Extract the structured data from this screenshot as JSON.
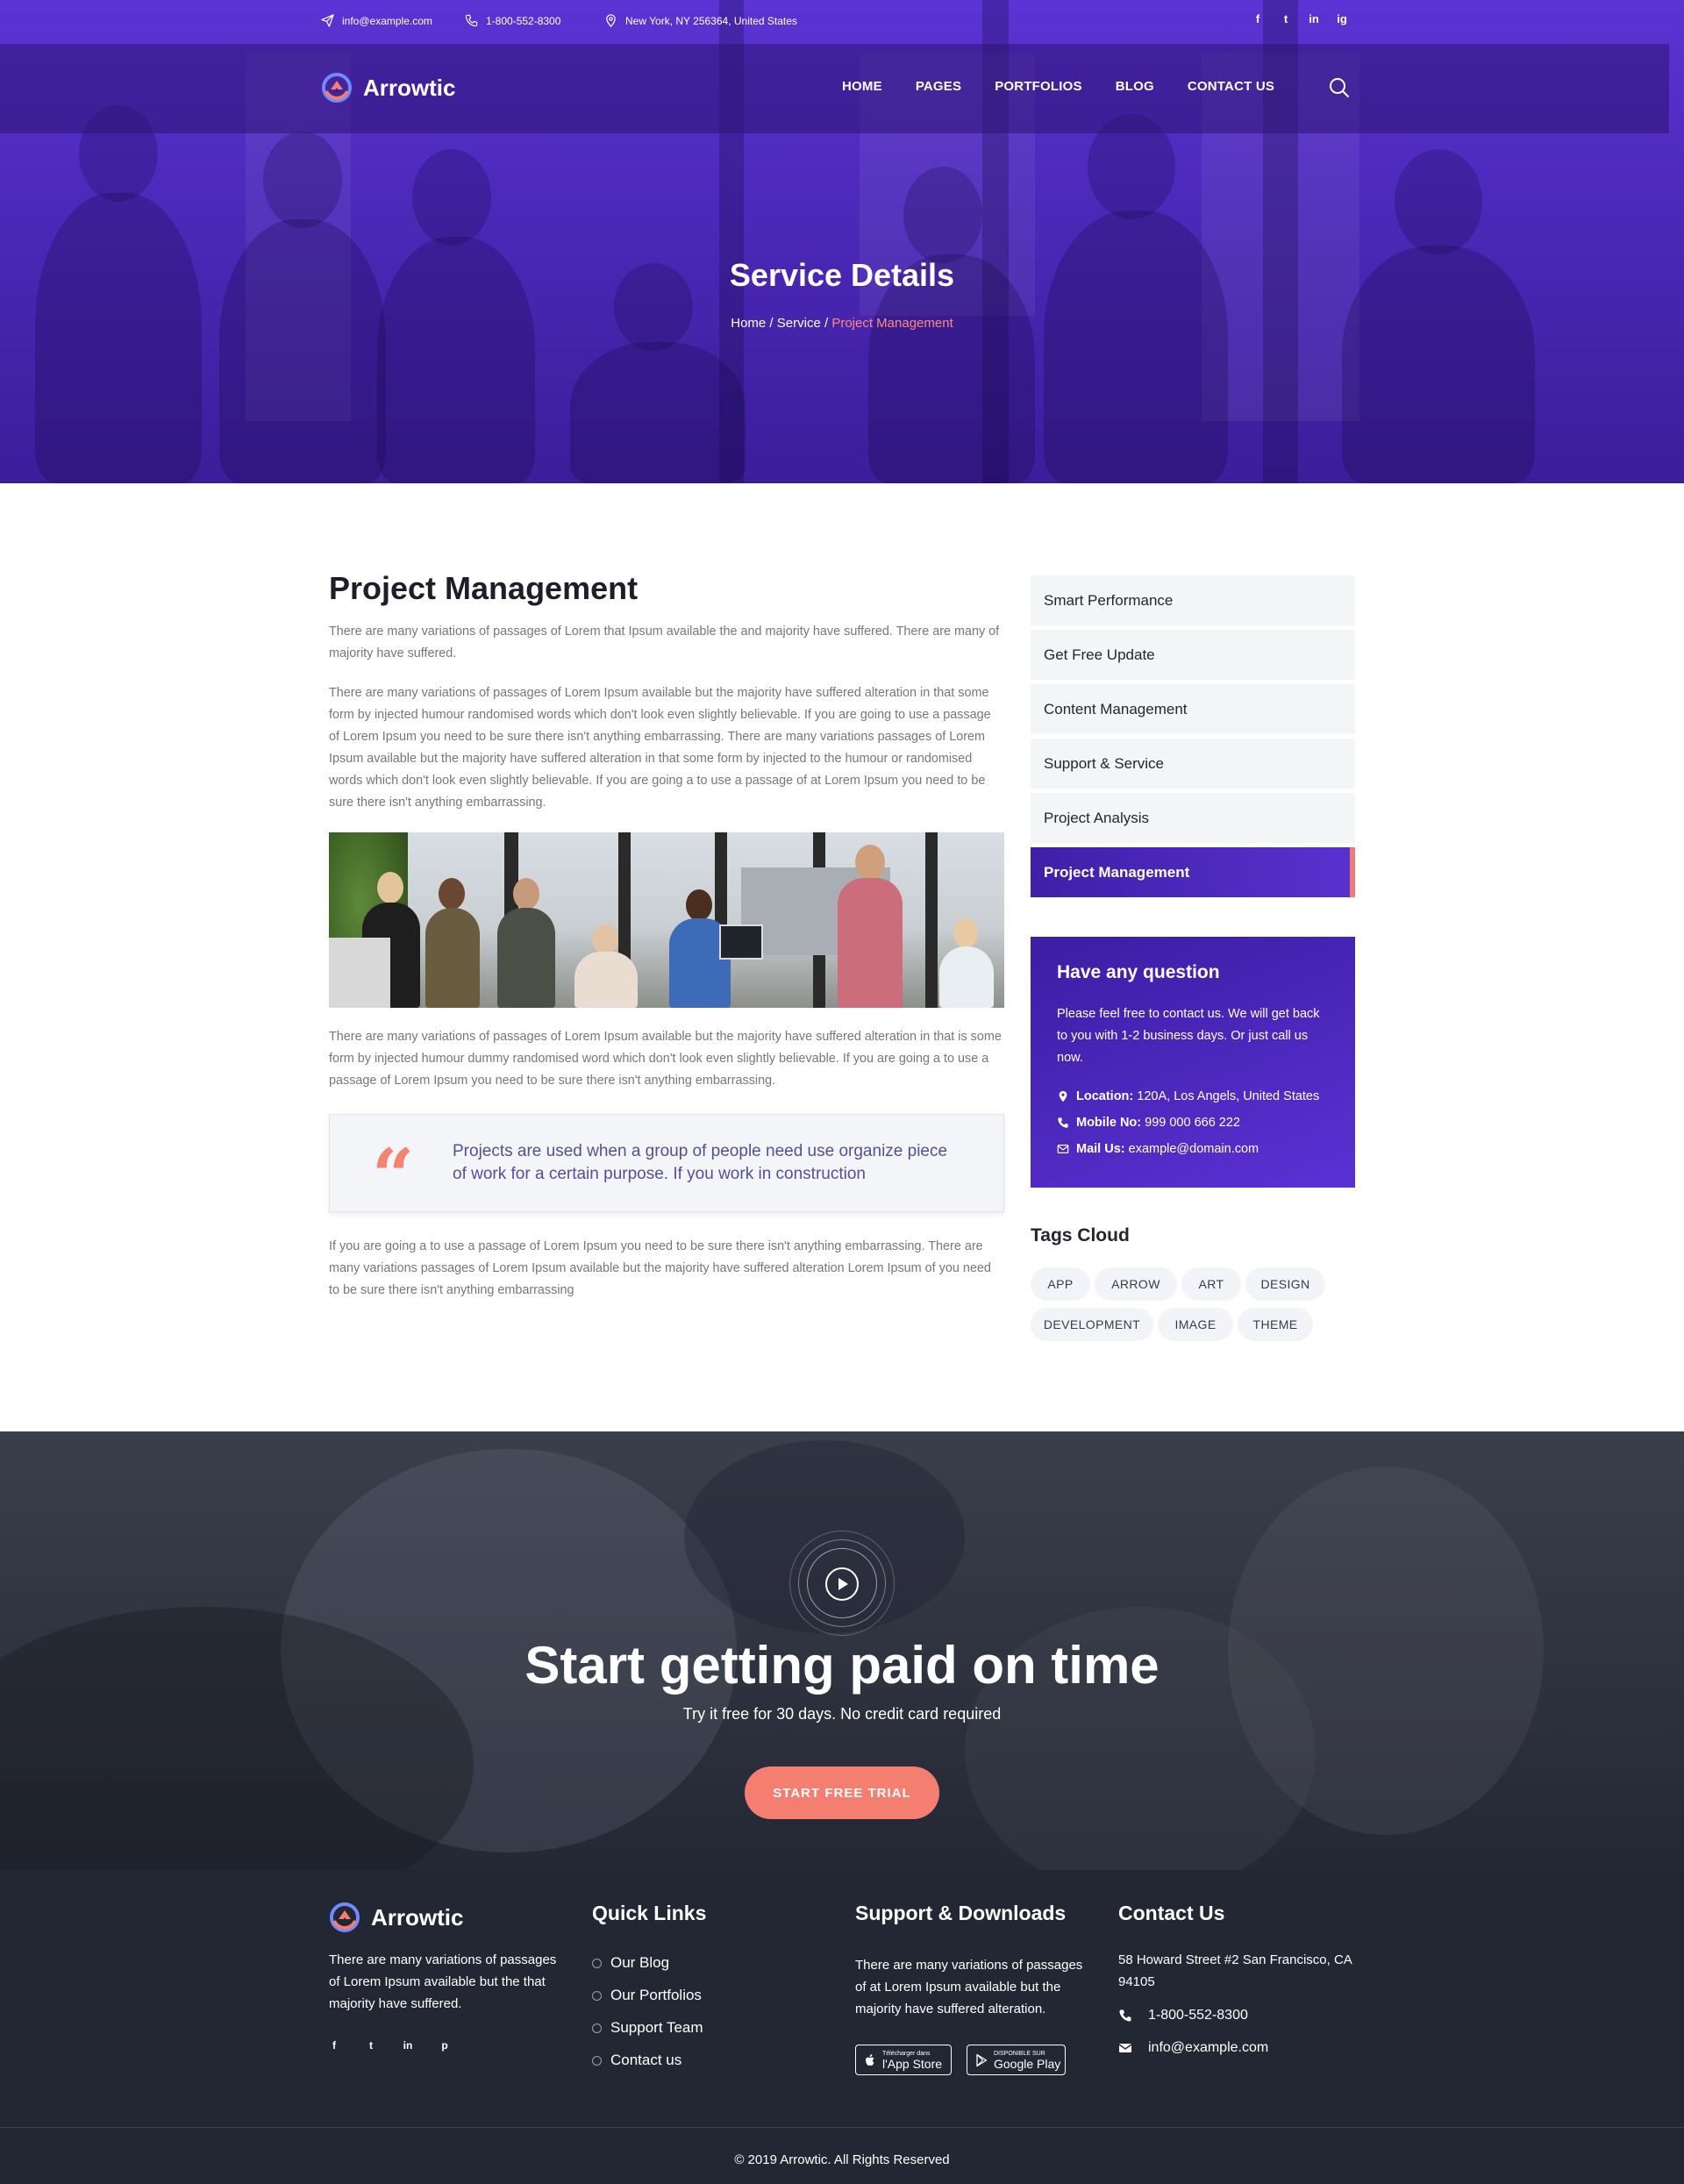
{
  "topbar": {
    "email": "info@example.com",
    "phone": "1-800-552-8300",
    "address": "New York, NY 256364, United States",
    "social": [
      "f",
      "t",
      "in",
      "ig"
    ]
  },
  "brand": {
    "name": "Arrowtic"
  },
  "nav": {
    "items": [
      "HOME",
      "PAGES",
      "PORTFOLIOS",
      "BLOG",
      "CONTACT US"
    ]
  },
  "hero": {
    "title": "Service Details",
    "breadcrumb": {
      "home": "Home",
      "sep": " / ",
      "service": "Service",
      "current": "Project Management"
    }
  },
  "article": {
    "title": "Project Management",
    "p1": "There are many variations of passages of Lorem that Ipsum available the and majority have suffered. There are many of majority have suffered.",
    "p2": "There are many variations of passages of Lorem Ipsum available but the majority have suffered alteration in that some form by injected humour randomised words which don't look even slightly believable. If you are going to use a passage of Lorem Ipsum you need to be sure there isn't anything embarrassing. There are many variations passages of Lorem Ipsum available but the majority have suffered alteration in that some form by injected to the humour or randomised words which don't look even slightly believable. If you are going a to use a passage of at Lorem Ipsum you need to be sure there isn't anything embarrassing.",
    "p3": "There are many variations of passages of Lorem Ipsum available but the majority have suffered alteration in that is some form by injected humour dummy randomised word which don't look even slightly believable. If you are going a to use a passage of Lorem Ipsum you need to be sure there isn't anything embarrassing.",
    "quote": "Projects are used when a group of people need use organize piece of work for a certain purpose. If you work in construction",
    "p4": "If you are going a to use a passage of Lorem Ipsum you need to be sure there isn't anything embarrassing. There are many variations passages of Lorem Ipsum available but the majority have suffered alteration Lorem Ipsum of you need to be sure there isn't anything embarrassing"
  },
  "sidebar": {
    "services": [
      {
        "label": "Smart Performance",
        "active": false
      },
      {
        "label": "Get Free Update",
        "active": false
      },
      {
        "label": "Content Management",
        "active": false
      },
      {
        "label": "Support & Service",
        "active": false
      },
      {
        "label": "Project Analysis",
        "active": false
      },
      {
        "label": "Project Management",
        "active": true
      }
    ],
    "contact": {
      "title": "Have any question",
      "text": "Please feel free to contact us. We will get back to you with 1-2 business days. Or just call us now.",
      "location_label": "Location:",
      "location": "120A, Los Angels, United States",
      "mobile_label": "Mobile No:",
      "mobile": "999 000 666 222",
      "mail_label": "Mail Us:",
      "mail": "example@domain.com"
    },
    "tags_title": "Tags Cloud",
    "tags": [
      "APP",
      "ARROW",
      "ART",
      "DESIGN",
      "DEVELOPMENT",
      "IMAGE",
      "THEME"
    ]
  },
  "cta": {
    "title": "Start getting paid on time",
    "subtitle": "Try it free for 30 days. No credit card required",
    "button": "START FREE TRIAL"
  },
  "footer": {
    "about": "There are many variations of passages of Lorem Ipsum available but the that majority have suffered.",
    "social": [
      "f",
      "t",
      "in",
      "p"
    ],
    "quick_links_title": "Quick Links",
    "quick_links": [
      "Our Blog",
      "Our Portfolios",
      "Support Team",
      "Contact us"
    ],
    "downloads_title": "Support & Downloads",
    "downloads_text": "There are many variations of passages of at Lorem Ipsum available but the majority have suffered alteration.",
    "app_store": {
      "small": "Télécharger dans",
      "big": "l'App Store"
    },
    "google_play": {
      "small": "DISPONIBLE SUR",
      "big": "Google Play"
    },
    "contact_title": "Contact Us",
    "address": "58 Howard Street #2 San Francisco, CA 94105",
    "phone": "1-800-552-8300",
    "email": "info@example.com",
    "copyright": "© 2019 Arrowtic. All Rights Reserved"
  },
  "colors": {
    "primary": "#4c28b8",
    "accent": "#f47e70",
    "dark": "#232734"
  }
}
